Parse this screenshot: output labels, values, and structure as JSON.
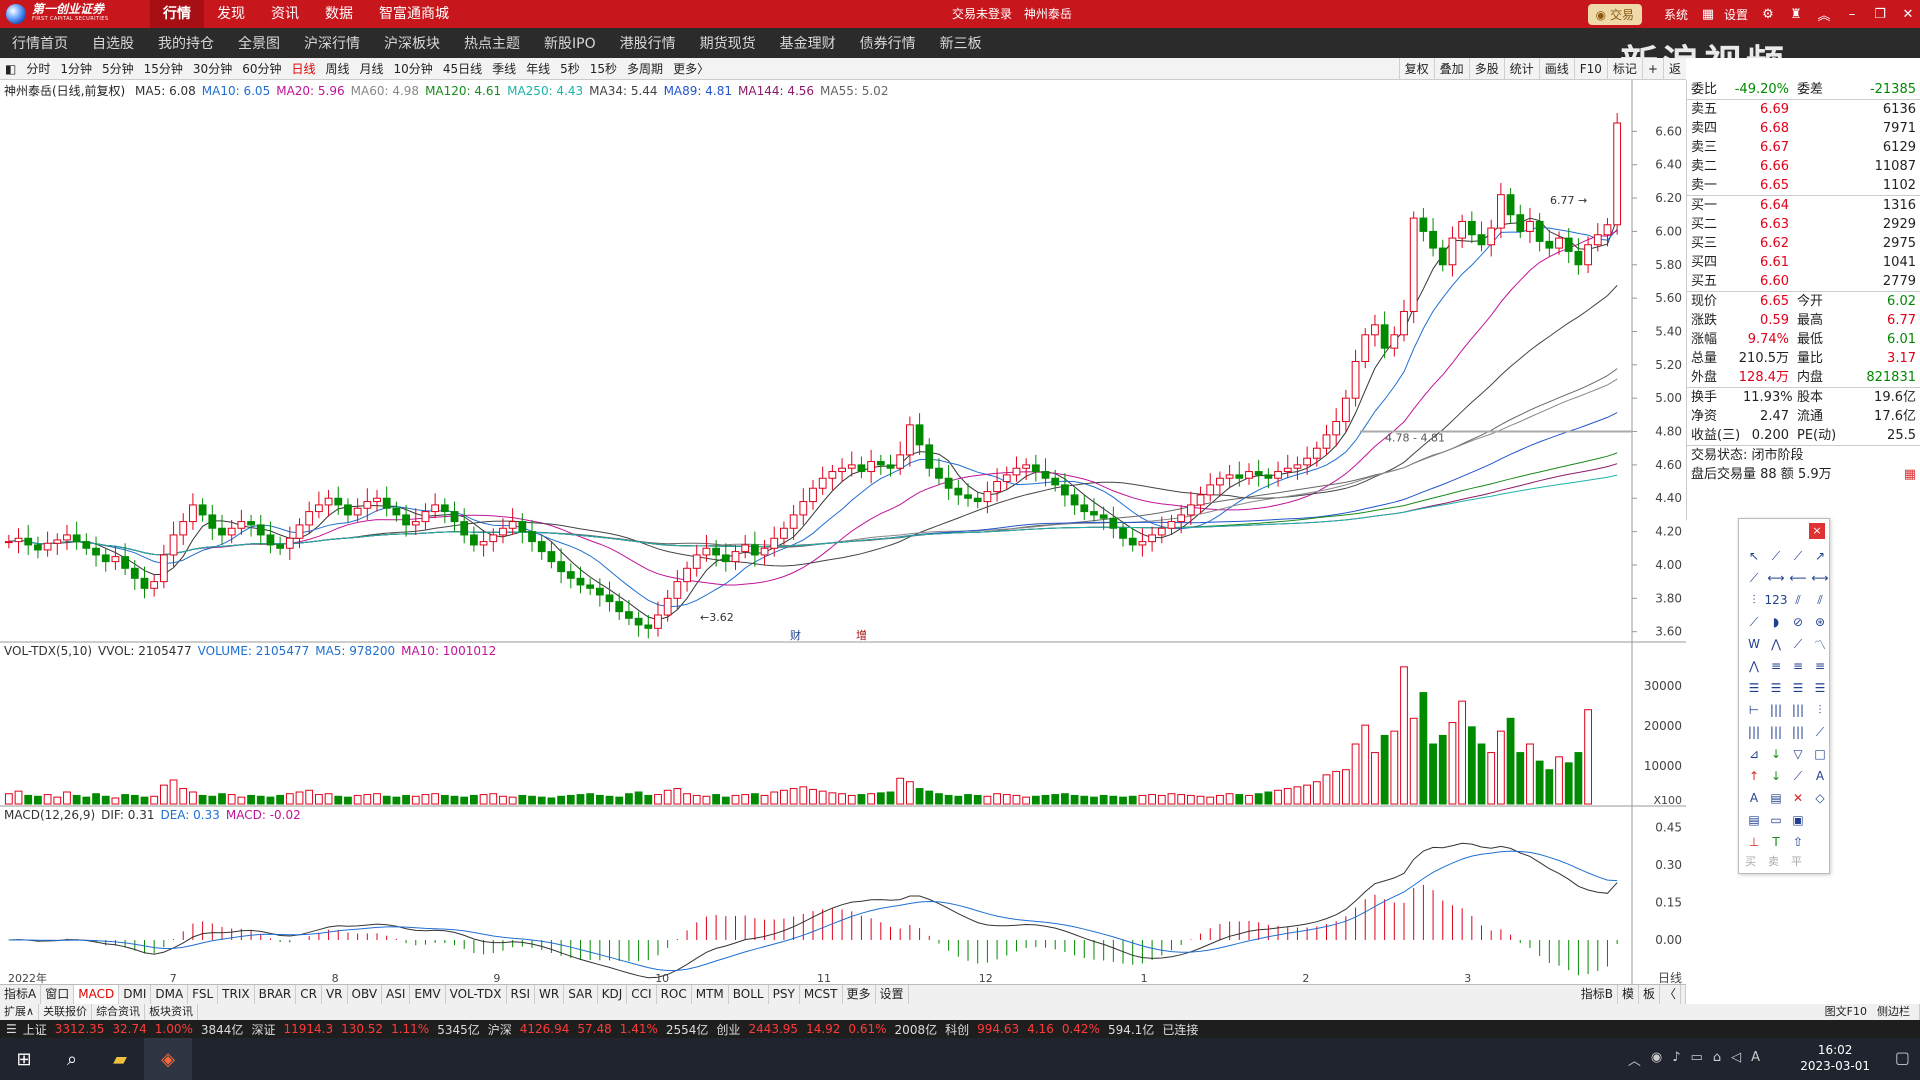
{
  "app": {
    "logo_main": "第一创业证券",
    "logo_sub": "FIRST CAPITAL SECURITIES",
    "login_status": "交易未登录",
    "stock_name_title": "神州泰岳",
    "main_nav": [
      "行情",
      "发现",
      "资讯",
      "数据",
      "智富通商城"
    ],
    "trade_button": "交易",
    "right_menu": [
      "系统",
      "设置"
    ]
  },
  "subnav": [
    "行情首页",
    "自选股",
    "我的持仓",
    "全景图",
    "沪深行情",
    "沪深板块",
    "热点主题",
    "新股IPO",
    "港股行情",
    "期货现货",
    "基金理财",
    "债券行情",
    "新三板"
  ],
  "watermark": "新浪视频",
  "periods": [
    "分时",
    "1分钟",
    "5分钟",
    "15分钟",
    "30分钟",
    "60分钟",
    "日线",
    "周线",
    "月线",
    "10分钟",
    "45日线",
    "季线",
    "年线",
    "5秒",
    "15秒",
    "多周期",
    "更多〉"
  ],
  "active_period": "日线",
  "chart_tools": [
    "复权",
    "叠加",
    "多股",
    "统计",
    "画线",
    "F10",
    "标记",
    "+",
    "返"
  ],
  "ma_legend": {
    "title": "神州泰岳(日线,前复权)",
    "items": [
      {
        "label": "MA5: 6.08",
        "color": "#333333"
      },
      {
        "label": "MA10: 6.05",
        "color": "#1f6fd1"
      },
      {
        "label": "MA20: 5.96",
        "color": "#c0149a"
      },
      {
        "label": "MA60: 4.98",
        "color": "#888888"
      },
      {
        "label": "MA120: 4.61",
        "color": "#1a8a1a"
      },
      {
        "label": "MA250: 4.43",
        "color": "#20b2aa"
      },
      {
        "label": "MA34: 5.44",
        "color": "#444444"
      },
      {
        "label": "MA89: 4.81",
        "color": "#2255cc"
      },
      {
        "label": "MA144: 4.56",
        "color": "#8b1a6b"
      },
      {
        "label": "MA55: 5.02",
        "color": "#666666"
      }
    ]
  },
  "vol_legend": [
    {
      "label": "VOL-TDX(5,10)",
      "color": "#333333"
    },
    {
      "label": "VVOL: 2105477",
      "color": "#333333"
    },
    {
      "label": "VOLUME: 2105477",
      "color": "#1f6fd1"
    },
    {
      "label": "MA5: 978200",
      "color": "#1f6fd1"
    },
    {
      "label": "MA10: 1001012",
      "color": "#c0149a"
    }
  ],
  "macd_legend": [
    {
      "label": "MACD(12,26,9)",
      "color": "#333333"
    },
    {
      "label": "DIF: 0.31",
      "color": "#333333"
    },
    {
      "label": "DEA: 0.33",
      "color": "#1f6fd1"
    },
    {
      "label": "MACD: -0.02",
      "color": "#c0149a"
    }
  ],
  "chart_data": [
    {
      "type": "candlestick",
      "title": "神州泰岳(日线,前复权)",
      "y_ticks": [
        "6.60",
        "6.40",
        "6.20",
        "6.00",
        "5.80",
        "5.60",
        "5.40",
        "5.20",
        "5.00",
        "4.80",
        "4.60",
        "4.40",
        "4.20",
        "4.00",
        "3.80",
        "3.60"
      ],
      "ylim": [
        3.55,
        6.8
      ],
      "x_labels": [
        "2022年",
        "7",
        "8",
        "9",
        "10",
        "11",
        "12",
        "1",
        "2",
        "3"
      ],
      "annotations": [
        "6.77",
        "3.62",
        "4.78 - 4.81"
      ],
      "markers": [
        "财",
        "增"
      ],
      "price_series": [
        4.14,
        4.16,
        4.12,
        4.09,
        4.13,
        4.15,
        4.18,
        4.14,
        4.1,
        4.06,
        4.02,
        4.05,
        3.98,
        3.92,
        3.86,
        3.9,
        4.06,
        4.18,
        4.26,
        4.36,
        4.3,
        4.22,
        4.18,
        4.22,
        4.26,
        4.24,
        4.18,
        4.12,
        4.1,
        4.16,
        4.24,
        4.32,
        4.36,
        4.4,
        4.36,
        4.3,
        4.34,
        4.38,
        4.4,
        4.34,
        4.3,
        4.24,
        4.26,
        4.32,
        4.36,
        4.32,
        4.26,
        4.18,
        4.12,
        4.14,
        4.18,
        4.22,
        4.26,
        4.2,
        4.14,
        4.08,
        4.02,
        3.96,
        3.92,
        3.88,
        3.86,
        3.82,
        3.78,
        3.72,
        3.68,
        3.64,
        3.62,
        3.7,
        3.8,
        3.9,
        3.98,
        4.06,
        4.1,
        4.06,
        4.02,
        4.08,
        4.12,
        4.06,
        4.1,
        4.16,
        4.22,
        4.3,
        4.38,
        4.46,
        4.52,
        4.56,
        4.58,
        4.6,
        4.56,
        4.62,
        4.6,
        4.58,
        4.66,
        4.84,
        4.72,
        4.58,
        4.52,
        4.46,
        4.42,
        4.4,
        4.38,
        4.44,
        4.5,
        4.54,
        4.58,
        4.6,
        4.56,
        4.52,
        4.48,
        4.42,
        4.36,
        4.32,
        4.3,
        4.28,
        4.22,
        4.16,
        4.12,
        4.14,
        4.18,
        4.22,
        4.26,
        4.3,
        4.36,
        4.42,
        4.48,
        4.52,
        4.54,
        4.52,
        4.56,
        4.54,
        4.52,
        4.56,
        4.58,
        4.6,
        4.64,
        4.7,
        4.78,
        4.86,
        5.0,
        5.22,
        5.38,
        5.44,
        5.3,
        5.38,
        5.52,
        6.08,
        6.0,
        5.9,
        5.8,
        5.96,
        6.06,
        5.98,
        5.92,
        6.02,
        6.22,
        6.1,
        6.0,
        6.06,
        5.94,
        5.9,
        5.96,
        5.88,
        5.8,
        5.92,
        5.98,
        6.04,
        6.65
      ],
      "volume_series": [
        12,
        15,
        10,
        9,
        11,
        8,
        14,
        10,
        8,
        12,
        9,
        7,
        11,
        10,
        8,
        9,
        22,
        28,
        18,
        14,
        10,
        9,
        12,
        11,
        8,
        10,
        9,
        8,
        10,
        12,
        14,
        16,
        11,
        12,
        9,
        8,
        10,
        11,
        12,
        9,
        8,
        10,
        9,
        11,
        12,
        10,
        9,
        8,
        10,
        11,
        12,
        9,
        8,
        10,
        9,
        8,
        7,
        9,
        10,
        11,
        12,
        10,
        9,
        8,
        12,
        14,
        10,
        11,
        16,
        18,
        12,
        10,
        9,
        11,
        8,
        10,
        11,
        12,
        10,
        14,
        16,
        18,
        20,
        17,
        15,
        13,
        12,
        10,
        11,
        12,
        13,
        14,
        30,
        26,
        18,
        15,
        12,
        10,
        9,
        11,
        10,
        9,
        12,
        11,
        10,
        8,
        9,
        10,
        11,
        12,
        10,
        9,
        8,
        10,
        9,
        8,
        9,
        10,
        11,
        10,
        12,
        11,
        10,
        9,
        8,
        10,
        12,
        11,
        10,
        12,
        14,
        16,
        18,
        20,
        22,
        26,
        34,
        38,
        40,
        70,
        92,
        60,
        80,
        85,
        160,
        100,
        130,
        70,
        80,
        95,
        120,
        90,
        70,
        60,
        85,
        100,
        60,
        70,
        50,
        40,
        55,
        48,
        60,
        110
      ],
      "volume_ticks": [
        "30000",
        "20000",
        "10000"
      ],
      "volume_unit": "X100",
      "macd_ticks": [
        "0.45",
        "0.30",
        "0.15",
        "0.00"
      ],
      "macd_ylim": [
        -0.12,
        0.48
      ]
    }
  ],
  "quote": {
    "weibi_label": "委比",
    "weibi": "-49.20%",
    "weicha_label": "委差",
    "weicha": "-21385",
    "sells": [
      {
        "label": "卖五",
        "price": "6.69",
        "vol": "6136"
      },
      {
        "label": "卖四",
        "price": "6.68",
        "vol": "7971"
      },
      {
        "label": "卖三",
        "price": "6.67",
        "vol": "6129"
      },
      {
        "label": "卖二",
        "price": "6.66",
        "vol": "11087"
      },
      {
        "label": "卖一",
        "price": "6.65",
        "vol": "1102"
      }
    ],
    "buys": [
      {
        "label": "买一",
        "price": "6.64",
        "vol": "1316"
      },
      {
        "label": "买二",
        "price": "6.63",
        "vol": "2929"
      },
      {
        "label": "买三",
        "price": "6.62",
        "vol": "2975"
      },
      {
        "label": "买四",
        "price": "6.61",
        "vol": "1041"
      },
      {
        "label": "买五",
        "price": "6.60",
        "vol": "2779"
      }
    ],
    "stats": [
      {
        "l1": "现价",
        "v1": "6.65",
        "c1": "red",
        "l2": "今开",
        "v2": "6.02",
        "c2": "grn"
      },
      {
        "l1": "涨跌",
        "v1": "0.59",
        "c1": "red",
        "l2": "最高",
        "v2": "6.77",
        "c2": "red"
      },
      {
        "l1": "涨幅",
        "v1": "9.74%",
        "c1": "red",
        "l2": "最低",
        "v2": "6.01",
        "c2": "grn"
      },
      {
        "l1": "总量",
        "v1": "210.5万",
        "c1": "",
        "l2": "量比",
        "v2": "3.17",
        "c2": "red"
      },
      {
        "l1": "外盘",
        "v1": "128.4万",
        "c1": "red",
        "l2": "内盘",
        "v2": "821831",
        "c2": "grn"
      }
    ],
    "stats2": [
      {
        "l1": "换手",
        "v1": "11.93%",
        "l2": "股本",
        "v2": "19.6亿"
      },
      {
        "l1": "净资",
        "v1": "2.47",
        "l2": "流通",
        "v2": "17.6亿"
      },
      {
        "l1": "收益(三)",
        "v1": "0.200",
        "l2": "PE(动)",
        "v2": "25.5"
      }
    ],
    "trade_state": "交易状态: 闭市阶段",
    "after_hours": "盘后交易量 88 额 5.9万"
  },
  "toolbox": {
    "close": "×",
    "tools": [
      "↖",
      "⟋",
      "⟋",
      "↗",
      "⟋",
      "⟷",
      "⟵",
      "⟷",
      "⫶",
      "123",
      "⫽",
      "⫽",
      "⟋",
      "◗",
      "⊘",
      "⊛",
      "W",
      "⋀",
      "⟋",
      "〽",
      "⋀",
      "≡",
      "≡",
      "≡",
      "☰",
      "☰",
      "☰",
      "☰",
      "⊢",
      "|||",
      "|||",
      "⫶",
      "|||",
      "|||",
      "|||",
      "⟋",
      "⊿",
      "↓",
      "▽",
      "□",
      "↑",
      "↓",
      "⟋",
      "A",
      "A",
      "▤",
      "✕",
      "◇",
      "▤",
      "▭",
      "▣",
      "",
      "⊥",
      "T",
      "⇧",
      ""
    ],
    "bottom": [
      "买",
      "卖",
      "平"
    ]
  },
  "tabs": [
    "指标A",
    "窗口",
    "MACD",
    "DMI",
    "DMA",
    "FSL",
    "TRIX",
    "BRAR",
    "CR",
    "VR",
    "OBV",
    "ASI",
    "EMV",
    "VOL-TDX",
    "RSI",
    "WR",
    "SAR",
    "KDJ",
    "CCI",
    "ROC",
    "MTM",
    "BOLL",
    "PSY",
    "MCST",
    "更多",
    "设置"
  ],
  "active_tab": "MACD",
  "tabs_right": [
    "指标B",
    "模",
    "板",
    "〈"
  ],
  "tabs2": [
    "扩展∧",
    "关联报价",
    "综合资讯",
    "板块资讯"
  ],
  "tabs2_right": [
    "图文F10",
    "侧边栏"
  ],
  "daily_label": "日线",
  "ticker": [
    {
      "t": "上证",
      "c": ""
    },
    {
      "t": "3312.35",
      "c": "red"
    },
    {
      "t": "32.74",
      "c": "red"
    },
    {
      "t": "1.00%",
      "c": "red"
    },
    {
      "t": "3844亿",
      "c": ""
    },
    {
      "t": "深证",
      "c": ""
    },
    {
      "t": "11914.3",
      "c": "red"
    },
    {
      "t": "130.52",
      "c": "red"
    },
    {
      "t": "1.11%",
      "c": "red"
    },
    {
      "t": "5345亿",
      "c": ""
    },
    {
      "t": "沪深",
      "c": ""
    },
    {
      "t": "4126.94",
      "c": "red"
    },
    {
      "t": "57.48",
      "c": "red"
    },
    {
      "t": "1.41%",
      "c": "red"
    },
    {
      "t": "2554亿",
      "c": ""
    },
    {
      "t": "创业",
      "c": ""
    },
    {
      "t": "2443.95",
      "c": "red"
    },
    {
      "t": "14.92",
      "c": "red"
    },
    {
      "t": "0.61%",
      "c": "red"
    },
    {
      "t": "2008亿",
      "c": ""
    },
    {
      "t": "科创",
      "c": ""
    },
    {
      "t": "994.63",
      "c": "red"
    },
    {
      "t": "4.16",
      "c": "red"
    },
    {
      "t": "0.42%",
      "c": "red"
    },
    {
      "t": "594.1亿",
      "c": ""
    },
    {
      "t": "已连接",
      "c": ""
    }
  ],
  "clock": {
    "time": "16:02",
    "date": "2023-03-01"
  }
}
